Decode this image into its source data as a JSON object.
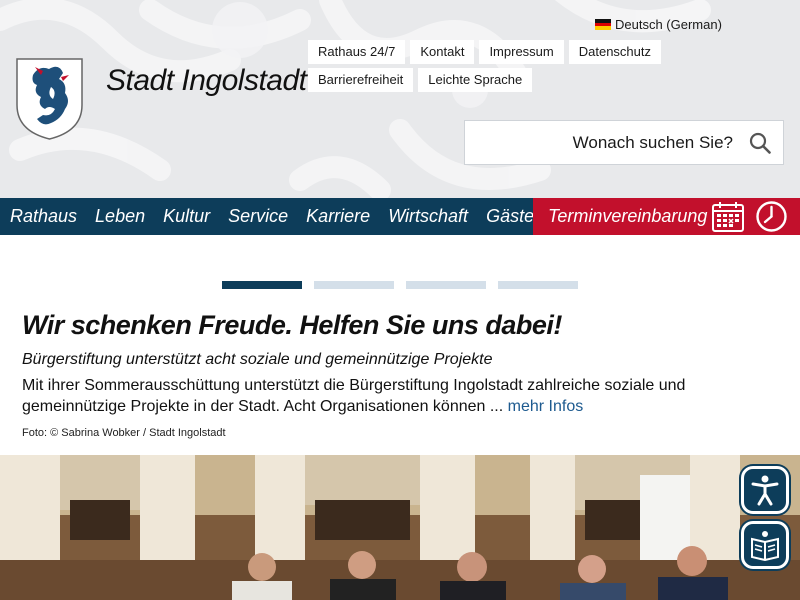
{
  "header": {
    "language": "Deutsch (German)",
    "site_title": "Stadt Ingolstadt",
    "top_links": [
      "Rathaus 24/7",
      "Kontakt",
      "Impressum",
      "Datenschutz",
      "Barrierefreiheit",
      "Leichte Sprache"
    ],
    "search_placeholder": "Wonach suchen Sie?"
  },
  "nav": {
    "items": [
      "Rathaus",
      "Leben",
      "Kultur",
      "Service",
      "Karriere",
      "Wirtschaft",
      "Gäste"
    ],
    "appointment": "Terminvereinbarung"
  },
  "slider": {
    "slide_count": 4,
    "active_index": 0,
    "headline": "Wir schenken Freude. Helfen Sie uns dabei!",
    "subheadline": "Bürgerstiftung unterstützt acht soziale und gemeinnützige Projekte",
    "teaser": "Mit ihrer Sommerausschüttung unterstützt die Bürgerstiftung Ingolstadt zahlreiche soziale und gemeinnützige Projekte in der Stadt. Acht Organisationen können ...",
    "more_link": "mehr Infos",
    "photo_credit": "Foto: © Sabrina Wobker / Stadt Ingolstadt"
  },
  "colors": {
    "primary": "#0d3d5a",
    "accent": "#c2102c",
    "header_bg": "#e8e9eb",
    "indicator_inactive": "#d4dfe9",
    "link": "#1d5a8f"
  },
  "icons": {
    "search": "search-icon",
    "calendar": "calendar-icon",
    "clock": "clock-icon",
    "accessibility": "accessibility-icon",
    "easy_read": "easy-read-icon"
  }
}
